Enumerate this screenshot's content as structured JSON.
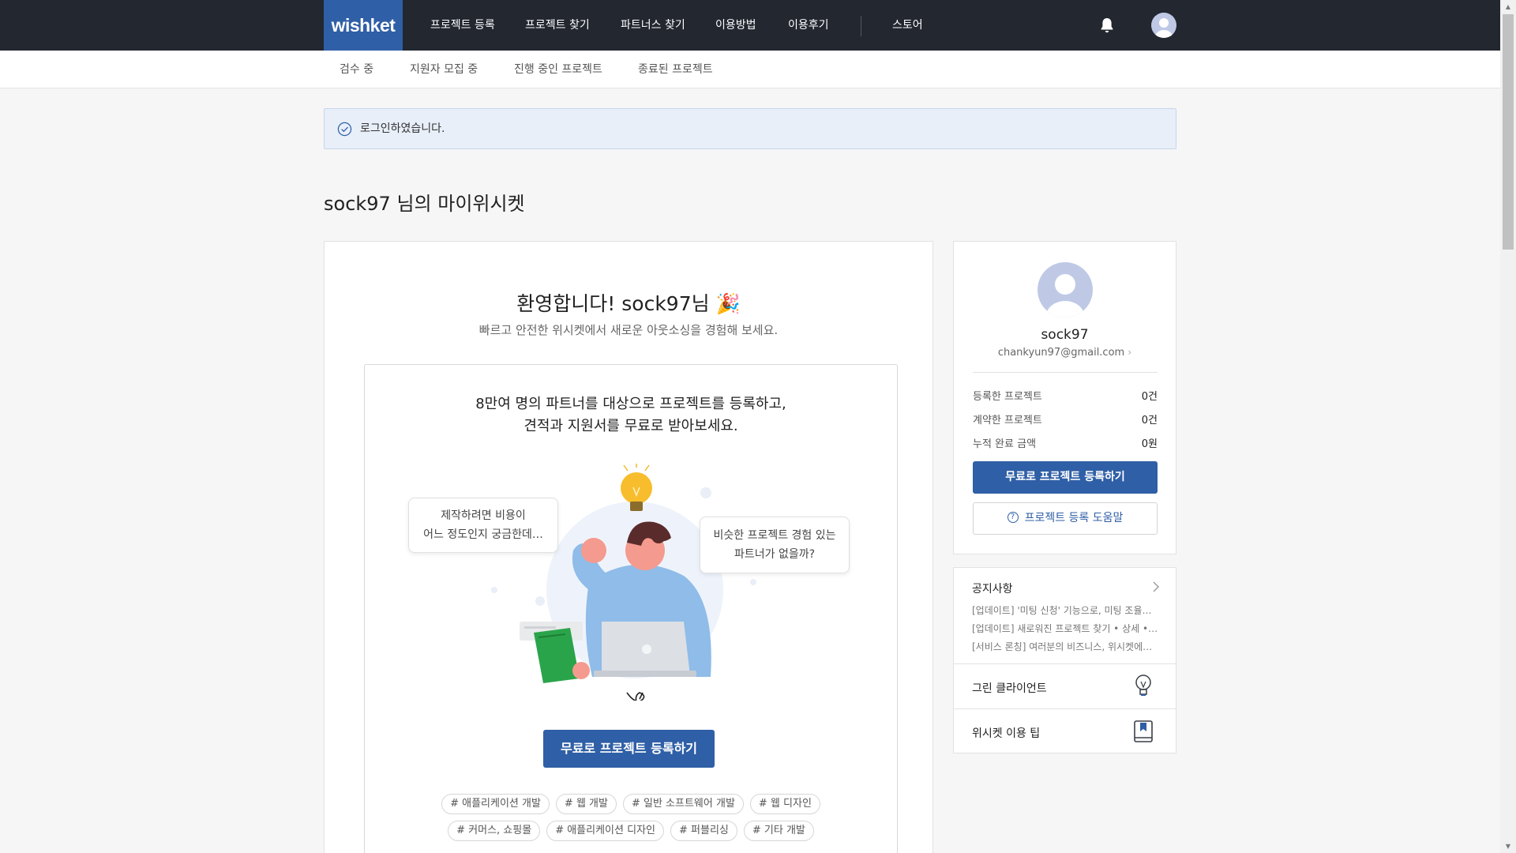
{
  "brand": {
    "logo": "wishket",
    "accent": "#2f5fa6",
    "nav_bg": "#222730"
  },
  "topnav": {
    "items": [
      "프로젝트 등록",
      "프로젝트 찾기",
      "파트너스 찾기",
      "이용방법",
      "이용후기"
    ],
    "store": "스토어",
    "icons": [
      "bell-icon",
      "avatar"
    ]
  },
  "subnav": {
    "items": [
      "검수 중",
      "지원자 모집 중",
      "진행 중인 프로젝트",
      "종료된 프로젝트"
    ]
  },
  "alert": {
    "icon": "check-circle-icon",
    "text": "로그인하였습니다."
  },
  "page_title": "sock97 님의 마이위시켓",
  "welcome": {
    "title": "환영합니다! sock97님 🎉",
    "subtitle": "빠르고 안전한 위시켓에서 새로운 아웃소싱을 경험해 보세요.",
    "promo_line1": "8만여 명의 파트너를 대상으로 프로젝트를 등록하고,",
    "promo_line2": "견적과 지원서를 무료로 받아보세요.",
    "bubble1_line1": "제작하려면 비용이",
    "bubble1_line2": "어느 정도인지 궁금한데…",
    "bubble2_line1": "비슷한 프로젝트 경험 있는",
    "bubble2_line2": "파트너가 없을까?",
    "cta": "무료로 프로젝트 등록하기",
    "tags_row1": [
      "# 애플리케이션 개발",
      "# 웹 개발",
      "# 일반 소프트웨어 개발",
      "# 웹 디자인"
    ],
    "tags_row2": [
      "# 커머스, 쇼핑몰",
      "# 애플리케이션 디자인",
      "# 퍼블리싱",
      "# 기타 개발"
    ]
  },
  "profile": {
    "name": "sock97",
    "email": "chankyun97@gmail.com",
    "stats": [
      {
        "label": "등록한 프로젝트",
        "value": "0건"
      },
      {
        "label": "계약한 프로젝트",
        "value": "0건"
      },
      {
        "label": "누적 완료 금액",
        "value": "0원"
      }
    ],
    "primary_button": "무료로 프로젝트 등록하기",
    "help_button": "프로젝트 등록 도움말"
  },
  "notice": {
    "title": "공지사항",
    "items": [
      "[업데이트] '미팅 신청' 기능으로, 미팅 조율이 쉬워졌어요",
      "[업데이트] 새로워진 프로젝트 찾기 • 상세 • 지원 페이지",
      "[서비스 론칭] 여러분의 비즈니스, 위시켓에서 성장하세요"
    ],
    "links": [
      {
        "label": "그린 클라이언트",
        "icon": "lightbulb-icon"
      },
      {
        "label": "위시켓 이용 팁",
        "icon": "book-icon"
      }
    ]
  }
}
